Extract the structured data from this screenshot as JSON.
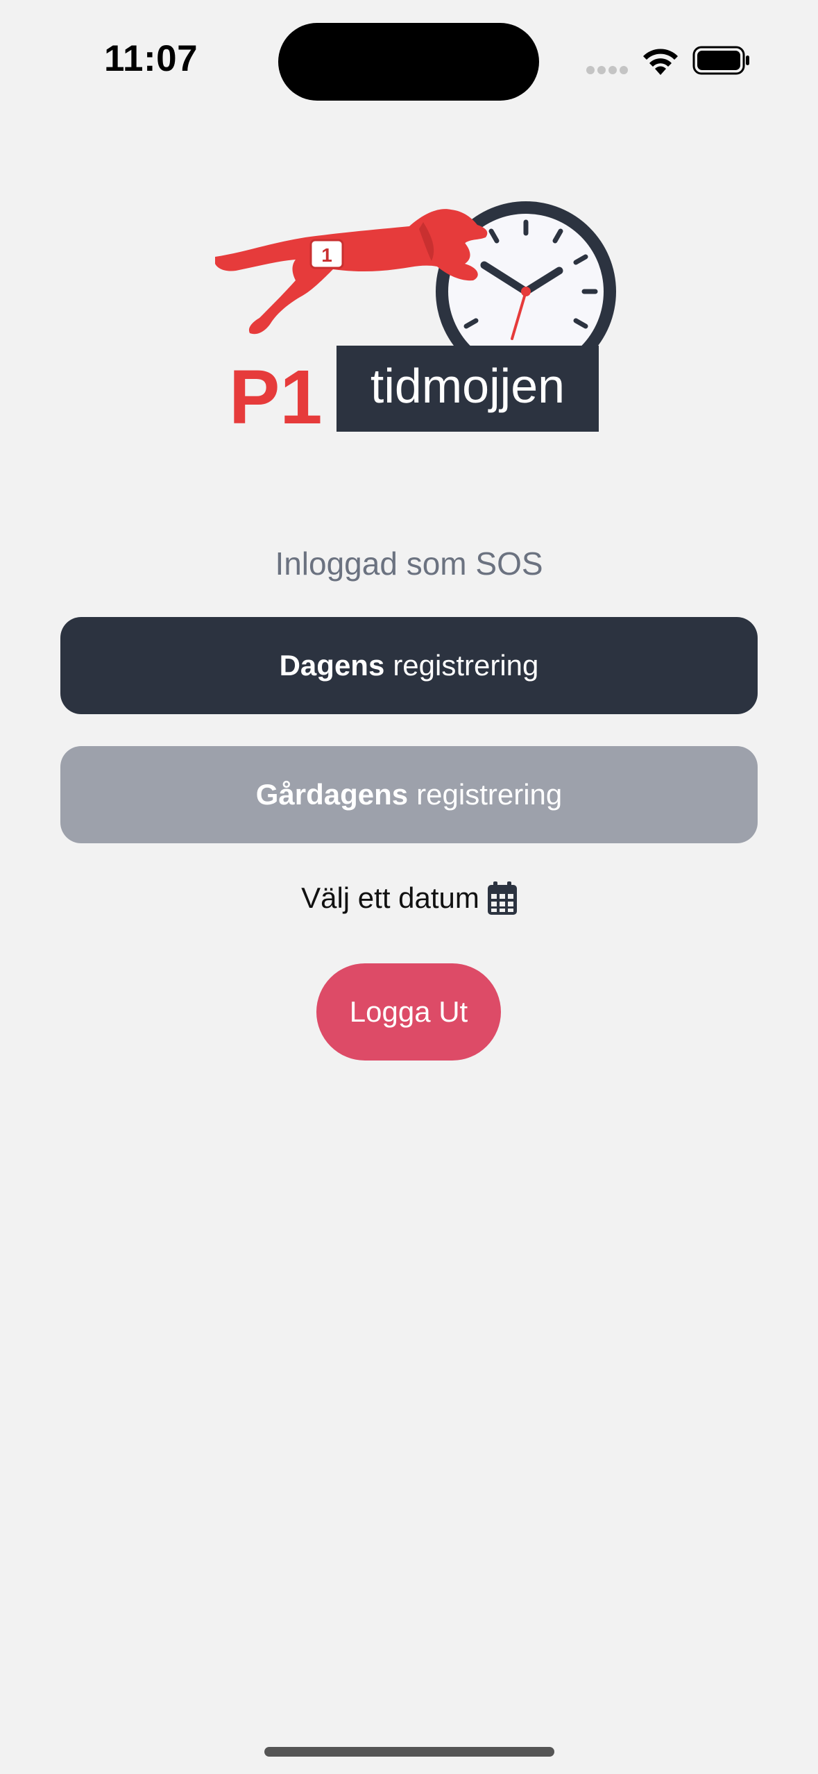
{
  "status_bar": {
    "time": "11:07"
  },
  "logo": {
    "brand_prefix": "P1",
    "brand_name": "tidmojjen",
    "bib_number": "1"
  },
  "session": {
    "logged_in_text": "Inloggad som SOS"
  },
  "actions": {
    "today": {
      "bold": "Dagens",
      "rest": "registrering"
    },
    "yesterday": {
      "bold": "Gårdagens",
      "rest": "registrering"
    },
    "choose_date_label": "Välj ett datum",
    "logout_label": "Logga Ut"
  },
  "colors": {
    "background": "#f2f2f2",
    "primary_button": "#2c3340",
    "secondary_button": "#9da1ab",
    "logout_button": "#dd4b67",
    "brand_red": "#e63b3b"
  }
}
